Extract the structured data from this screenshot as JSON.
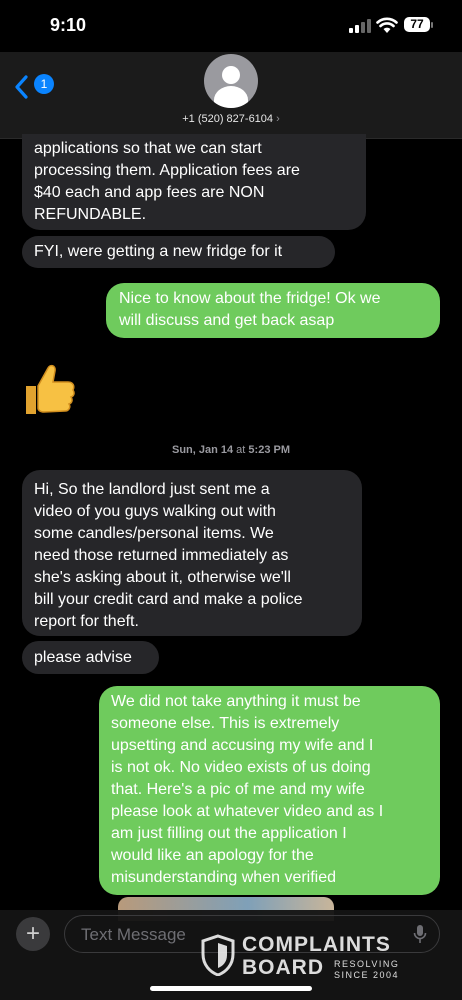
{
  "status_bar": {
    "time": "9:10",
    "battery": "77"
  },
  "header": {
    "back_badge": "1",
    "contact_number": "+1 (520) 827-6104",
    "contact_chevron": "›"
  },
  "messages": [
    {
      "direction": "incoming",
      "text": "applications so that we can start\nprocessing them.  Application fees are\n$40 each and app fees are NON\nREFUNDABLE."
    },
    {
      "direction": "incoming",
      "text": "FYI, were getting a new fridge for it"
    },
    {
      "direction": "outgoing",
      "text": "Nice to know about the fridge! Ok we\nwill discuss and get back asap"
    },
    {
      "direction": "outgoing",
      "text": "👍",
      "type": "emoji"
    },
    {
      "direction": "incoming",
      "text": "Hi, So the landlord just sent me a\nvideo of you guys walking out with\nsome candles/personal items.  We\nneed those returned immediately as\nshe's asking about it, otherwise we'll\nbill your credit card and make a police\nreport for theft."
    },
    {
      "direction": "incoming",
      "text": "please advise"
    },
    {
      "direction": "outgoing",
      "text": "We did not take anything it must be\nsomeone else.  This is extremely\nupsetting and accusing my wife and I\nis not ok.  No video exists of us doing\nthat.  Here's a pic of me and my wife\nplease look at whatever video and as I\nam just filling out the application I\nwould like an apology for the\nmisunderstanding when verified"
    }
  ],
  "timestamp": {
    "day": "Sun, Jan 14",
    "at": " at ",
    "time": "5:23 PM"
  },
  "input": {
    "plus": "+",
    "placeholder": "Text Message"
  },
  "watermark": {
    "line1": "COMPLAINTS",
    "line2": "BOARD",
    "tag1": "RESOLVING",
    "tag2": "SINCE 2004"
  },
  "colors": {
    "incoming_bubble": "#262629",
    "outgoing_bubble": "#6fcb5d",
    "accent": "#0a84ff"
  },
  "icons": [
    "signal-icon",
    "wifi-icon",
    "battery-icon",
    "back-chevron-icon",
    "avatar-icon",
    "mic-icon",
    "complaints-board-logo"
  ]
}
